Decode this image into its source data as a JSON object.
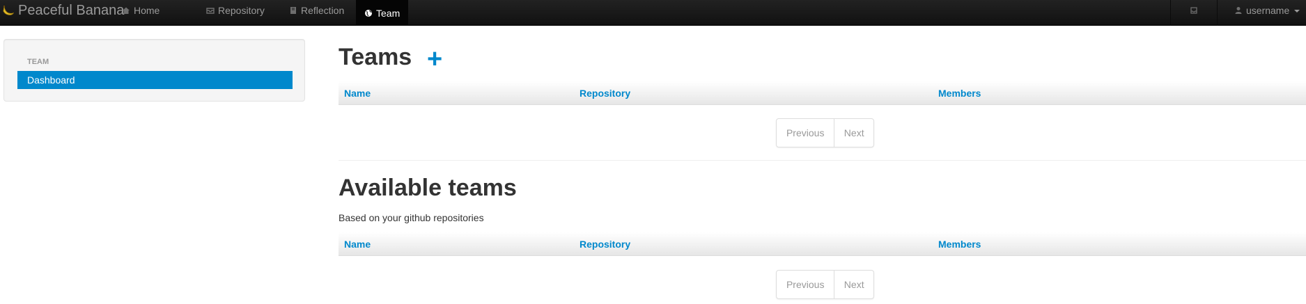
{
  "navbar": {
    "brand": "Peaceful Banana",
    "items": [
      {
        "label": "Home",
        "icon": "home-icon"
      },
      {
        "label": "Repository",
        "icon": "inbox-icon"
      },
      {
        "label": "Reflection",
        "icon": "book-icon"
      },
      {
        "label": "Team",
        "icon": "globe-icon",
        "active": true
      }
    ],
    "user": "username"
  },
  "sidebar": {
    "header": "TEAM",
    "items": [
      {
        "label": "Dashboard",
        "active": true
      }
    ]
  },
  "teams": {
    "title": "Teams",
    "add_label": "+",
    "columns": [
      "Name",
      "Repository",
      "Members"
    ],
    "rows": [],
    "pagination": {
      "previous": "Previous",
      "next": "Next"
    }
  },
  "available_teams": {
    "title": "Available teams",
    "subtitle": "Based on your github repositories",
    "columns": [
      "Name",
      "Repository",
      "Members"
    ],
    "rows": [],
    "pagination": {
      "previous": "Previous",
      "next": "Next"
    }
  },
  "colors": {
    "accent": "#0088cc",
    "navbar": "#1b1b1b",
    "sidebar_bg": "#f5f5f5"
  }
}
